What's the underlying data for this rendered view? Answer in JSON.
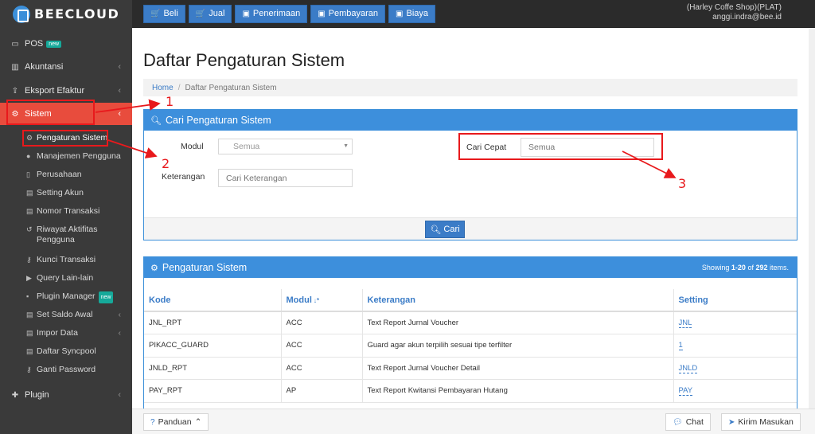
{
  "brand": {
    "logo_text": "BEECLOUD",
    "accent": "#3b8fd9",
    "sidebar_active": "#e84c3d",
    "annotation_color": "#e8191c"
  },
  "topbar": {
    "buttons": [
      {
        "icon": "cart-icon",
        "label": "Beli"
      },
      {
        "icon": "cart-icon",
        "label": "Jual"
      },
      {
        "icon": "money-icon",
        "label": "Penerimaan"
      },
      {
        "icon": "money-icon",
        "label": "Pembayaran"
      },
      {
        "icon": "money-icon",
        "label": "Biaya"
      }
    ],
    "user": {
      "shop": "(Harley Coffe Shop)(PLAT)",
      "email": "anggi.indra@bee.id"
    }
  },
  "sidebar": {
    "items": [
      {
        "label": "POS",
        "badge": "new",
        "icon": "monitor-icon"
      },
      {
        "label": "Akuntansi",
        "icon": "chart-icon"
      },
      {
        "label": "Eksport Efaktur",
        "icon": "upload-icon"
      },
      {
        "label": "Sistem",
        "icon": "gears-icon"
      },
      {
        "label": "Plugin",
        "icon": "puzzle-icon"
      }
    ],
    "sub_items": [
      {
        "label": "Pengaturan Sistem",
        "icon": "gear-icon"
      },
      {
        "label": "Manajemen Pengguna",
        "icon": "users-icon"
      },
      {
        "label": "Perusahaan",
        "icon": "building-icon"
      },
      {
        "label": "Setting Akun",
        "icon": "list-icon"
      },
      {
        "label": "Nomor Transaksi",
        "icon": "list-icon"
      },
      {
        "label": "Riwayat Aktifitas Pengguna",
        "icon": "history-icon"
      },
      {
        "label": "Kunci Transaksi",
        "icon": "key-icon"
      },
      {
        "label": "Query Lain-lain",
        "icon": "play-icon"
      },
      {
        "label": "Plugin Manager",
        "badge": "new",
        "icon": "plug-icon"
      },
      {
        "label": "Set Saldo Awal",
        "icon": "list-icon"
      },
      {
        "label": "Impor Data",
        "icon": "import-icon"
      },
      {
        "label": "Daftar Syncpool",
        "icon": "list-icon"
      },
      {
        "label": "Ganti Password",
        "icon": "key-icon"
      }
    ]
  },
  "main": {
    "title": "Daftar Pengaturan Sistem",
    "breadcrumb": {
      "home": "Home",
      "current": "Daftar Pengaturan Sistem"
    },
    "search_panel": {
      "title": "Cari Pengaturan Sistem",
      "modul_label": "Modul",
      "modul_value": "Semua",
      "keterangan_label": "Keterangan",
      "keterangan_placeholder": "Cari Keterangan",
      "cari_cepat_label": "Cari Cepat",
      "cari_cepat_placeholder": "Semua",
      "button": "Cari"
    },
    "list_panel": {
      "title": "Pengaturan Sistem",
      "showing_prefix": "Showing ",
      "showing_range": "1-20",
      "showing_mid": " of ",
      "showing_total": "292",
      "showing_suffix": " items.",
      "columns": [
        "Kode",
        "Modul",
        "Keterangan",
        "Setting"
      ],
      "rows": [
        {
          "kode": "JNL_RPT",
          "modul": "ACC",
          "keterangan": "Text Report Jurnal Voucher",
          "setting": "JNL"
        },
        {
          "kode": "PIKACC_GUARD",
          "modul": "ACC",
          "keterangan": "Guard agar akun terpilih sesuai tipe terfilter",
          "setting": "1"
        },
        {
          "kode": "JNLD_RPT",
          "modul": "ACC",
          "keterangan": "Text Report Jurnal Voucher Detail",
          "setting": "JNLD"
        },
        {
          "kode": "PAY_RPT",
          "modul": "AP",
          "keterangan": "Text Report Kwitansi Pembayaran Hutang",
          "setting": "PAY"
        }
      ]
    }
  },
  "bottombar": {
    "panduan": "Panduan",
    "chat": "Chat",
    "kirim": "Kirim Masukan"
  },
  "annotations": [
    "1",
    "2",
    "3"
  ]
}
